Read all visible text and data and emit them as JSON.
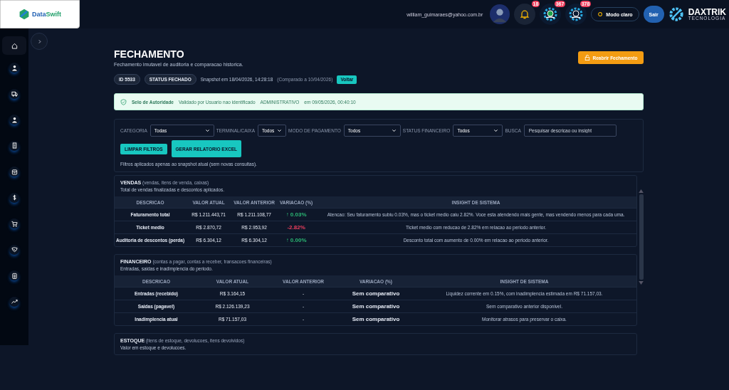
{
  "brand": {
    "name_part1": "Data",
    "name_part2": "Swift"
  },
  "header": {
    "email": "william_guimaraes@yahoo.com.br",
    "notifications": "18",
    "badges": [
      "367",
      "378"
    ],
    "theme_button": "Modo claro",
    "logout": "Sair",
    "company": "DAXTRIK",
    "company_sub": "TECNOLOGIA"
  },
  "page": {
    "title": "FECHAMENTO",
    "subtitle": "Fechamento imutavel de auditoria e comparacao historica.",
    "reopen_button": "Reabrir Fechamento",
    "id_chip": "ID 5533",
    "status_chip": "STATUS FECHADO",
    "snapshot": "Snapshot em 18/04/2026, 14:28:18",
    "compared": "(Comparado a 10/04/2026)",
    "back_button": "Voltar"
  },
  "seal": {
    "label": "Selo de Autoridade",
    "validated": "Validado por Usuario nao identificado",
    "role": "ADMINISTRATIVO",
    "date": "em 09/05/2026, 00:40:10"
  },
  "filters": {
    "fields": [
      {
        "label": "CATEGORIA",
        "value": "Todas",
        "kind": "select"
      },
      {
        "label": "TERMINAL/CAIXA",
        "value": "Todos",
        "kind": "select"
      },
      {
        "label": "MODO DE PAGAMENTO",
        "value": "Todos",
        "kind": "select"
      },
      {
        "label": "STATUS FINANCEIRO",
        "value": "Todos",
        "kind": "select"
      },
      {
        "label": "BUSCA",
        "placeholder": "Pesquisar descricao ou insight",
        "kind": "search"
      }
    ],
    "buttons": [
      "LIMPAR FILTROS",
      "GERAR RELATORIO EXCEL"
    ],
    "note": "Filtros aplicados apenas ao snapshot atual (sem novas consultas)."
  },
  "sections": [
    {
      "title": "VENDAS",
      "scope": "(vendas, itens de venda, caixas)",
      "description": "Total de vendas finalizadas e descontos aplicados.",
      "columns": [
        "DESCRICAO",
        "VALOR ATUAL",
        "VALOR ANTERIOR",
        "VARIACAO (%)",
        "INSIGHT DE SISTEMA"
      ],
      "rows": [
        {
          "description": "Faturamento total",
          "current": "R$ 1.211.443,71",
          "previous": "R$ 1.211.108,77",
          "variation": "↑ 0.03%",
          "color": "#2bb673",
          "insight": "Atencao: Seu faturamento subiu 0.03%, mas o ticket medio caiu 2.82%. Voce esta atendendo mais gente, mas vendendo menos para cada uma."
        },
        {
          "description": "Ticket medio",
          "current": "R$ 2.870,72",
          "previous": "R$ 2.953,92",
          "variation": "-2.82%",
          "color": "#ef3f5e",
          "insight": "Ticket medio com reducao de 2.82% em relacao ao periodo anterior."
        },
        {
          "description": "Auditoria de descontos (perda)",
          "current": "R$ 6.304,12",
          "previous": "R$ 6.304,12",
          "variation": "↑ 0.00%",
          "color": "#2bb673",
          "insight": "Desconto total com aumento de 0.00% em relacao ao periodo anterior."
        }
      ]
    },
    {
      "title": "FINANCEIRO",
      "scope": "(contas a pagar, contas a receber, transacoes financeiras)",
      "description": "Entradas, saidas e inadimplencia do periodo.",
      "columns": [
        "DESCRICAO",
        "VALOR ATUAL",
        "VALOR ANTERIOR",
        "VARIACAO (%)",
        "INSIGHT DE SISTEMA"
      ],
      "rows": [
        {
          "description": "Entradas (recebido)",
          "current": "R$ 3.164,15",
          "previous": "-",
          "variation": "Sem comparativo",
          "color": "#e6ebf5",
          "insight": "Liquidez corrente em 0.15%, com inadimplencia estimada em R$ 71.157,03."
        },
        {
          "description": "Saidas (pagavel)",
          "current": "R$ 2.126.139,23",
          "previous": "-",
          "variation": "Sem comparativo",
          "color": "#e6ebf5",
          "insight": "Sem comparativo anterior disponivel."
        },
        {
          "description": "Inadimplencia atual",
          "current": "R$ 71.157,03",
          "previous": "-",
          "variation": "Sem comparativo",
          "color": "#e6ebf5",
          "insight": "Monitorar atrasos para preservar o caixa."
        }
      ]
    },
    {
      "title": "ESTOQUE",
      "scope": "(itens de estoque, devolucoes, itens devolvidos)",
      "description": "Valor em estoque e devolucoes."
    }
  ]
}
